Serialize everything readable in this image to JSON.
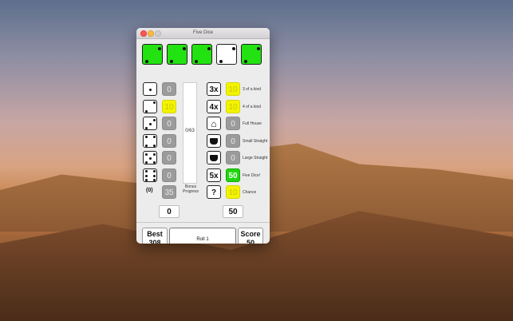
{
  "window": {
    "title": "Five Dice"
  },
  "dice": [
    {
      "value": 2,
      "held": true
    },
    {
      "value": 2,
      "held": true
    },
    {
      "value": 2,
      "held": true
    },
    {
      "value": 2,
      "held": false
    },
    {
      "value": 2,
      "held": true
    }
  ],
  "colors": {
    "held": "#22e211",
    "free": "#ffffff",
    "yellow": "#f3f300",
    "green": "#1fd60e",
    "gray": "#9b9b9b"
  },
  "upper": [
    {
      "face": 1,
      "score": "0",
      "style": "gray"
    },
    {
      "face": 2,
      "score": "10",
      "style": "yellow"
    },
    {
      "face": 3,
      "score": "0",
      "style": "gray"
    },
    {
      "face": 4,
      "score": "0",
      "style": "gray"
    },
    {
      "face": 5,
      "score": "0",
      "style": "gray"
    },
    {
      "face": 6,
      "score": "0",
      "style": "gray"
    }
  ],
  "bonus": {
    "count_label": "(0)",
    "score": "35",
    "progress_text": "0/63",
    "progress_value": 0,
    "label_line1": "Bonus",
    "label_line2": "Progress"
  },
  "lower": [
    {
      "icon_text": "3x",
      "icon_name": "three-times-icon",
      "score": "10",
      "style": "yellow",
      "label": "3 of a kind"
    },
    {
      "icon_text": "4x",
      "icon_name": "four-times-icon",
      "score": "10",
      "style": "yellow",
      "label": "4 of a kind"
    },
    {
      "icon_text": "⌂",
      "icon_name": "house-icon",
      "score": "0",
      "style": "gray",
      "label": "Full House"
    },
    {
      "icon_text": "",
      "icon_name": "small-straight-icon",
      "score": "0",
      "style": "gray",
      "label": "Small Straight"
    },
    {
      "icon_text": "",
      "icon_name": "large-straight-icon",
      "score": "0",
      "style": "gray",
      "label": "Large Straight"
    },
    {
      "icon_text": "5x",
      "icon_name": "five-times-icon",
      "score": "50",
      "style": "green",
      "label": "Five Dice!"
    },
    {
      "icon_text": "?",
      "icon_name": "question-icon",
      "score": "10",
      "style": "yellow",
      "label": "Chance"
    }
  ],
  "totals": {
    "upper": "0",
    "lower": "50"
  },
  "footer": {
    "best_label": "Best",
    "best_value": "308",
    "roll_label": "Roll 1",
    "score_label": "Score",
    "score_value": "50"
  }
}
